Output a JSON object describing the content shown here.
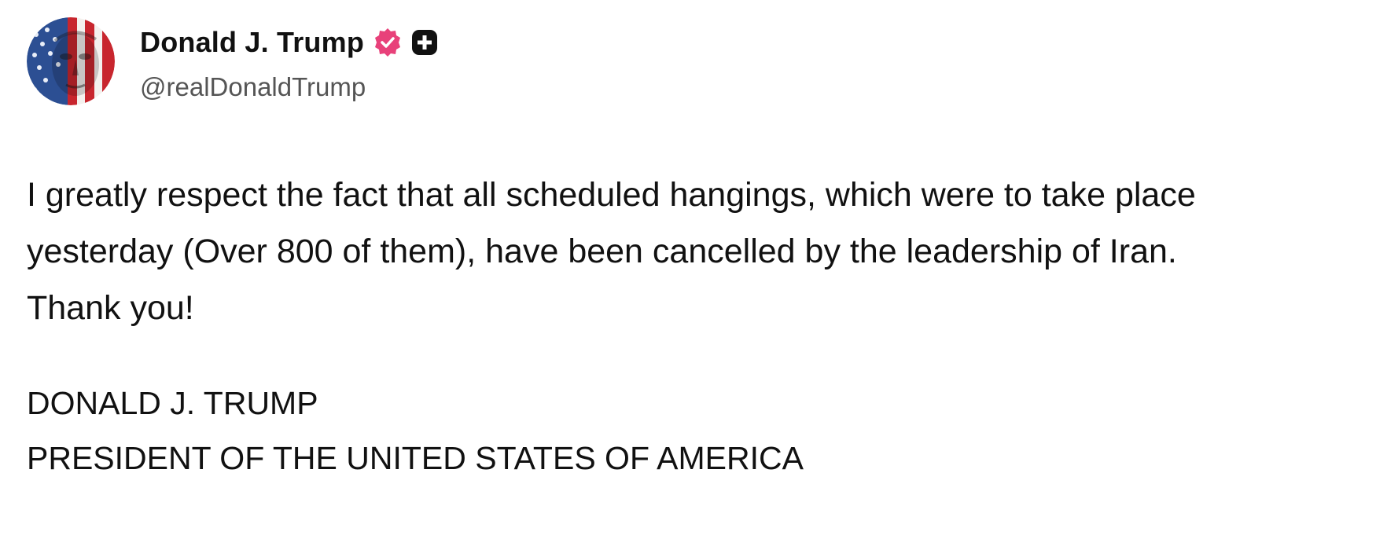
{
  "post": {
    "author": {
      "display_name": "Donald J. Trump",
      "handle": "@realDonaldTrump",
      "avatar_icon": "flag-portrait-avatar",
      "badges": [
        "verified-badge-icon",
        "plus-badge-icon"
      ],
      "badge_colors": {
        "verified": "#e8417a",
        "plus": "#111111"
      }
    },
    "text": "I greatly respect the fact that all scheduled hangings, which were to take place yesterday (Over 800 of them), have been cancelled by the leadership of Iran. Thank you!",
    "signature": {
      "line1": "DONALD J. TRUMP",
      "line2": "PRESIDENT OF THE UNITED STATES OF AMERICA"
    }
  }
}
